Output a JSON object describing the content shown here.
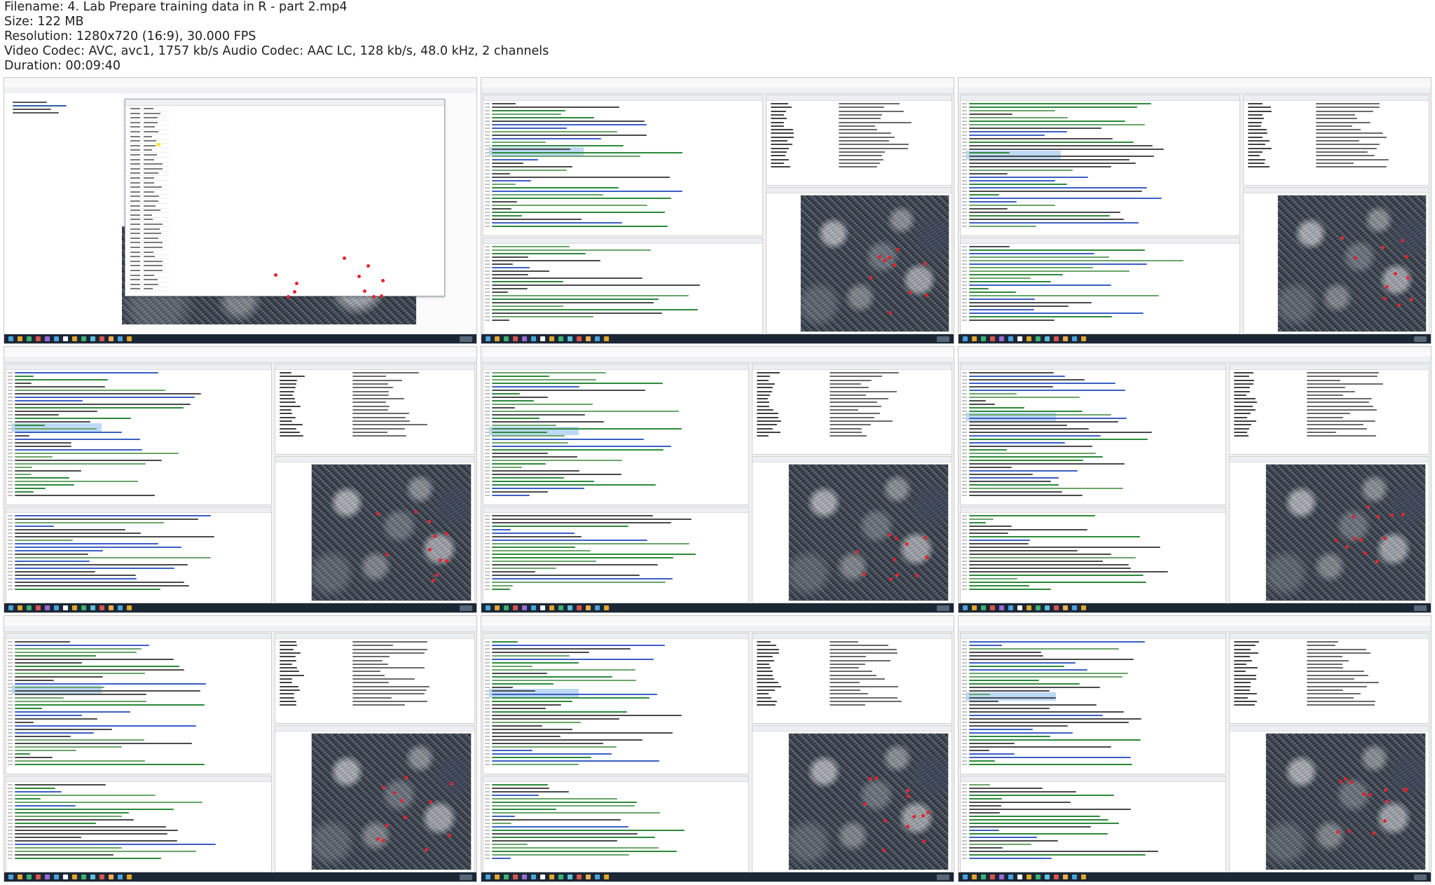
{
  "header": {
    "filename": "Filename: 4. Lab Prepare training data in R - part 2.mp4",
    "size": "Size: 122 MB",
    "resolution": "Resolution: 1280x720 (16:9), 30.000 FPS",
    "codecs": "Video Codec: AVC, avc1, 1757 kb/s Audio Codec: AAC LC, 128 kb/s, 48.0 kHz, 2 channels",
    "duration": "Duration: 00:09:40"
  },
  "thumbnails": [
    {
      "app": "QGIS",
      "content": "attribute-table-over-satellite-image"
    },
    {
      "app": "RStudio",
      "content": "script-with-satellite-plot"
    },
    {
      "app": "RStudio",
      "content": "script-with-satellite-plot"
    },
    {
      "app": "RStudio",
      "content": "script-with-satellite-plot"
    },
    {
      "app": "RStudio",
      "content": "script-with-satellite-plot"
    },
    {
      "app": "RStudio",
      "content": "script-with-satellite-plot"
    },
    {
      "app": "RStudio",
      "content": "script-with-satellite-plot"
    },
    {
      "app": "RStudio",
      "content": "script-with-satellite-plot"
    },
    {
      "app": "RStudio",
      "content": "script-with-satellite-plot"
    }
  ],
  "colors": {
    "editor_bg": "#ffffff",
    "chrome_bg": "#f2f2f2",
    "taskbar": "#1b2735",
    "selection": "#bcd9f5",
    "code_comment": "#6aa56a",
    "code_keyword": "#3b5fc4",
    "code_string": "#2c8a3a",
    "code_plain": "#4a4a4a",
    "training_point": "#e8242e"
  }
}
